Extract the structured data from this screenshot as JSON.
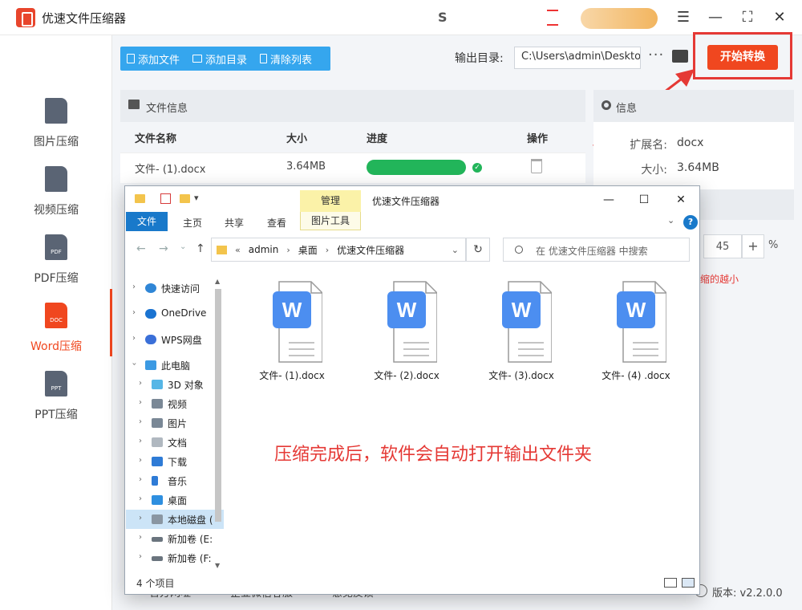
{
  "app": {
    "title": "优速文件压缩器",
    "promo_text": "S"
  },
  "sidebar": {
    "items": [
      {
        "label": "图片压缩",
        "badge": ""
      },
      {
        "label": "视频压缩",
        "badge": ""
      },
      {
        "label": "PDF压缩",
        "badge": "PDF"
      },
      {
        "label": "Word压缩",
        "badge": "DOC",
        "active": true
      },
      {
        "label": "PPT压缩",
        "badge": "PPT"
      }
    ]
  },
  "toolbar": {
    "add_file": "添加文件",
    "add_folder": "添加目录",
    "clear_list": "清除列表",
    "output_label": "输出目录:",
    "output_path": "C:\\Users\\admin\\Deskto",
    "more": "···",
    "start": "开始转换"
  },
  "file_panel": {
    "title": "文件信息",
    "columns": [
      "文件名称",
      "大小",
      "进度",
      "操作"
    ],
    "rows": [
      {
        "name": "文件- (1).docx",
        "size": "3.64MB",
        "progress": 1.0
      }
    ]
  },
  "info_panel": {
    "title": "信息",
    "ext_label": "扩展名:",
    "ext_value": "docx",
    "size_label": "大小:",
    "size_value": "3.64MB",
    "quality_value": "45",
    "quality_plus": "+",
    "quality_pct": "%",
    "hint": "缩的越小"
  },
  "footer": {
    "items": [
      "官方网址",
      "企业微信客服",
      "意见反馈"
    ],
    "version_label": "版本:",
    "version": "v2.2.0.0"
  },
  "explorer": {
    "manage_tab": "管理",
    "window_title": "优速文件压缩器",
    "picture_tools": "图片工具",
    "tabs": [
      "文件",
      "主页",
      "共享",
      "查看"
    ],
    "path": [
      "admin",
      "桌面",
      "优速文件压缩器"
    ],
    "path_prefix": "«",
    "search_placeholder": "在 优速文件压缩器 中搜索",
    "tree": [
      {
        "label": "快速访问",
        "icon": "star-icon"
      },
      {
        "label": "OneDrive",
        "icon": "cloud-icon"
      },
      {
        "label": "WPS网盘",
        "icon": "cloud-icon"
      },
      {
        "label": "此电脑",
        "icon": "computer-icon",
        "expanded": true
      },
      {
        "label": "3D 对象",
        "icon": "cube-icon"
      },
      {
        "label": "视频",
        "icon": "video-icon"
      },
      {
        "label": "图片",
        "icon": "picture-icon"
      },
      {
        "label": "文档",
        "icon": "document-icon"
      },
      {
        "label": "下载",
        "icon": "download-icon"
      },
      {
        "label": "音乐",
        "icon": "music-icon"
      },
      {
        "label": "桌面",
        "icon": "desktop-icon"
      },
      {
        "label": "本地磁盘 (",
        "icon": "drive-icon",
        "selected": true
      },
      {
        "label": "新加卷 (E:",
        "icon": "drive-icon"
      },
      {
        "label": "新加卷 (F:",
        "icon": "drive-icon"
      }
    ],
    "files": [
      "文件- (1).docx",
      "文件- (2).docx",
      "文件- (3).docx",
      "文件- (4) .docx"
    ],
    "file_badge": "W",
    "status": "4 个项目",
    "annotation": "压缩完成后，软件会自动打开输出文件夹"
  },
  "colors": {
    "accent": "#f0471f",
    "toolbar_blue": "#35a6ee",
    "progress_green": "#22b55a",
    "highlight_red": "#e53935",
    "word_blue": "#4c8ef0"
  }
}
